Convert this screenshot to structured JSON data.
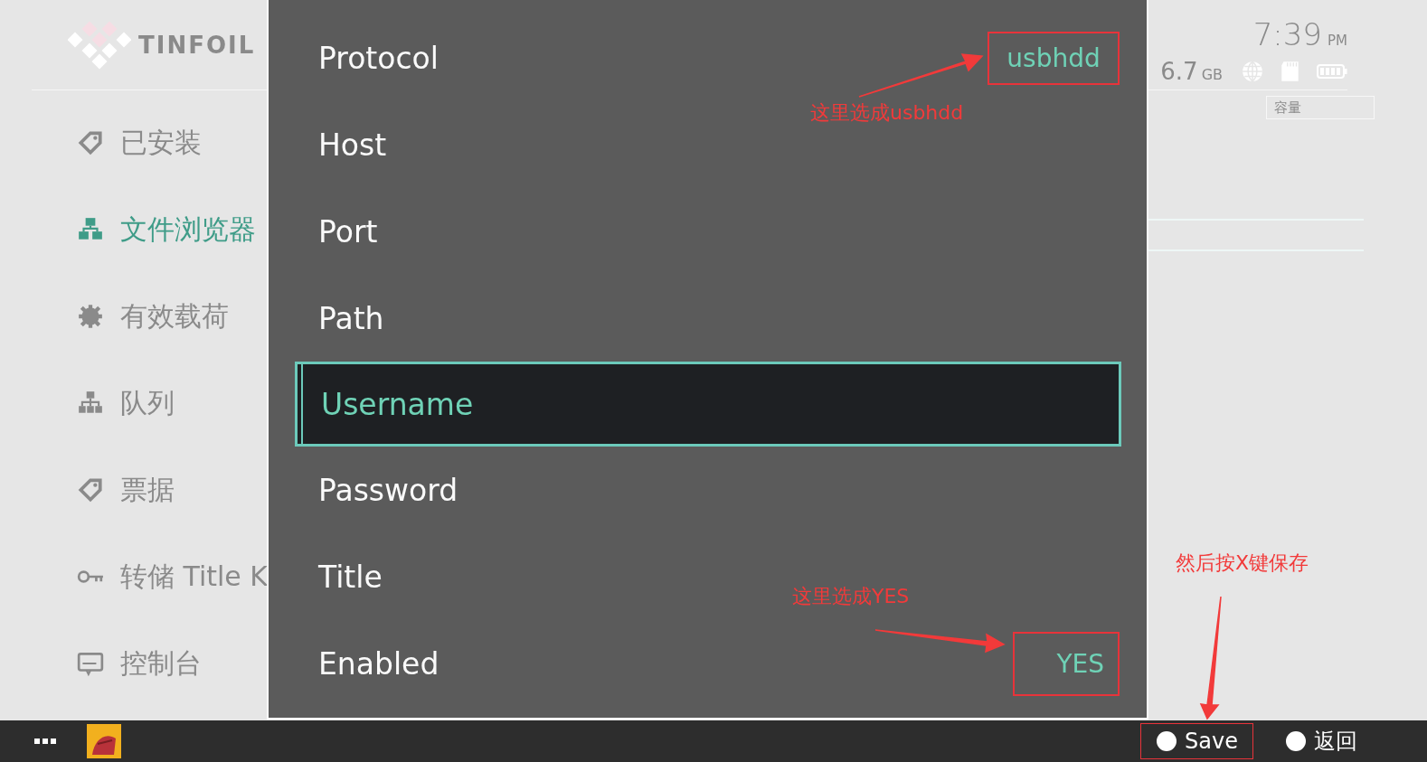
{
  "header": {
    "logo": "TINFOIL",
    "time": "7:39",
    "meridiem": "PM",
    "free_space": "6.7",
    "unit": "GB"
  },
  "sidebar": {
    "items": [
      {
        "label": "已安装",
        "kind": "tag",
        "selected": false
      },
      {
        "label": "文件浏览器",
        "kind": "network",
        "selected": true
      },
      {
        "label": "有效载荷",
        "kind": "gear",
        "selected": false
      },
      {
        "label": "队列",
        "kind": "hierarchy",
        "selected": false
      },
      {
        "label": "票据",
        "kind": "tag",
        "selected": false
      },
      {
        "label": "转储 Title K",
        "kind": "key",
        "selected": false
      },
      {
        "label": "控制台",
        "kind": "console",
        "selected": false
      }
    ]
  },
  "table": {
    "columns": [
      "容量"
    ]
  },
  "dialog": {
    "fields": [
      {
        "label": "Protocol",
        "value": "usbhdd",
        "selected": false,
        "highlighted": true
      },
      {
        "label": "Host",
        "selected": false
      },
      {
        "label": "Port",
        "selected": false
      },
      {
        "label": "Path",
        "selected": false
      },
      {
        "label": "Username",
        "selected": true
      },
      {
        "label": "Password",
        "selected": false
      },
      {
        "label": "Title",
        "selected": false
      },
      {
        "label": "Enabled",
        "value": "YES",
        "selected": false,
        "highlighted": true
      }
    ]
  },
  "bottom_bar": {
    "actions": [
      {
        "label": "Save",
        "highlighted": true
      },
      {
        "label": "返回",
        "highlighted": false
      }
    ]
  },
  "annotations": [
    {
      "text": "这里选成usbhdd",
      "kind": "protocol"
    },
    {
      "text": "这里选成YES",
      "kind": "enabled"
    },
    {
      "text": "然后按X键保存",
      "kind": "save"
    }
  ]
}
